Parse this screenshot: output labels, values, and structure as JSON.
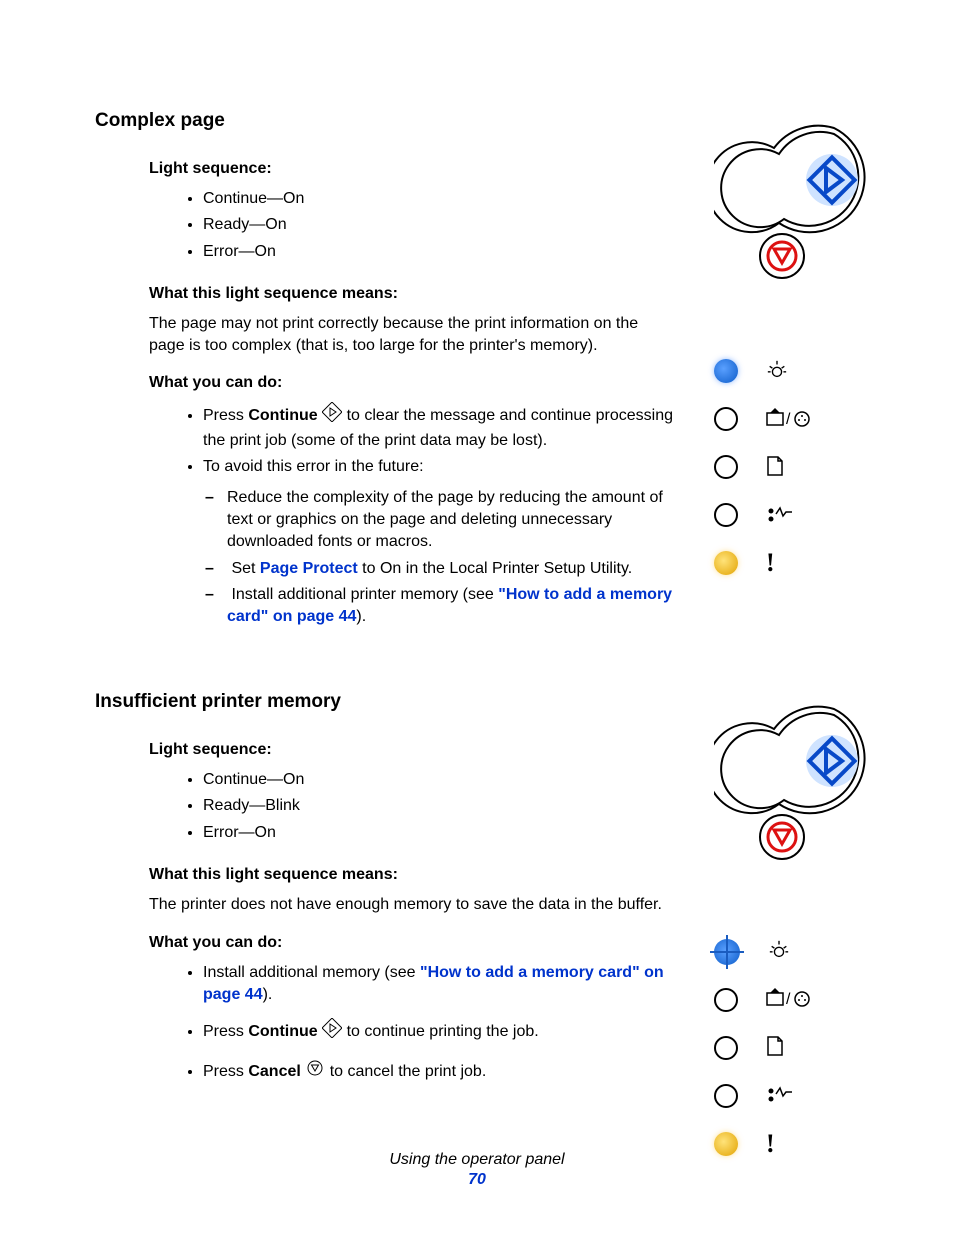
{
  "footer": {
    "section_title": "Using the operator panel",
    "page_number": "70"
  },
  "sections": [
    {
      "heading": "Complex page",
      "ls_label": "Light sequence:",
      "ls": [
        "Continue—On",
        "Ready—On",
        "Error—On"
      ],
      "means_label": "What this light sequence means:",
      "means_body": "The page may not print correctly because the print information on the page is too complex (that is, too large for the printer's memory).",
      "do_label": "What you can do:",
      "do": {
        "a_pre": "Press ",
        "a_bold": "Continue",
        "a_post": " to clear the message and continue processing the print job (some of the print data may be lost).",
        "b": "To avoid this error in the future:",
        "c": "Reduce the complexity of the page by reducing the amount of text or graphics on the page and deleting unnecessary downloaded fonts or macros.",
        "d_pre": "Set ",
        "d_link": "Page Protect",
        "d_post": " to On in the Local Printer Setup Utility.",
        "e_pre": "Install additional printer memory (see ",
        "e_link": "\"How to add a memory card\" on page 44",
        "e_post": ")."
      },
      "lights": [
        {
          "type": "blue",
          "icon": "light-bulb"
        },
        {
          "type": "off",
          "icon": "toner"
        },
        {
          "type": "off",
          "icon": "paper"
        },
        {
          "type": "off",
          "icon": "jam"
        },
        {
          "type": "amber",
          "icon": "error"
        }
      ]
    },
    {
      "heading": "Insufficient printer memory",
      "ls_label": "Light sequence:",
      "ls": [
        "Continue—On",
        "Ready—Blink",
        "Error—On"
      ],
      "means_label": "What this light sequence means:",
      "means_body": "The printer does not have enough memory to save the data in the buffer.",
      "do_label": "What you can do:",
      "do2": {
        "a_pre": "Install additional memory (see ",
        "a_link": "\"How to add a memory card\" on page 44",
        "a_post": ").",
        "b_pre": "Press ",
        "b_bold": "Continue",
        "b_post": " to continue printing the job.",
        "c_pre": "Press ",
        "c_bold": "Cancel",
        "c_post": " to cancel the print job."
      },
      "lights": [
        {
          "type": "blueblink",
          "icon": "light-bulb"
        },
        {
          "type": "off",
          "icon": "toner"
        },
        {
          "type": "off",
          "icon": "paper"
        },
        {
          "type": "off",
          "icon": "jam"
        },
        {
          "type": "amber",
          "icon": "error"
        }
      ]
    }
  ]
}
